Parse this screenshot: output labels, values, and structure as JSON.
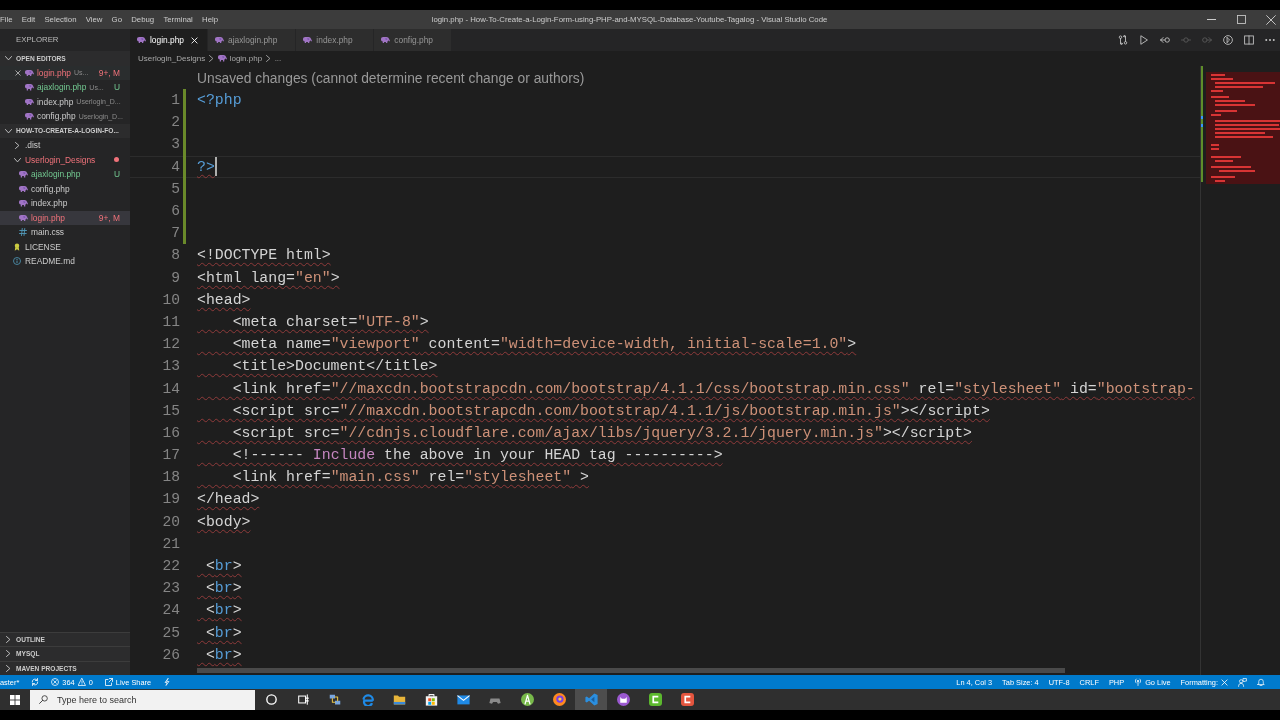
{
  "window": {
    "title": "login.php - How-To-Create-a-Login-Form-using-PHP-and-MYSQL-Database-Youtube-Tagalog - Visual Studio Code"
  },
  "menu": [
    "File",
    "Edit",
    "Selection",
    "View",
    "Go",
    "Debug",
    "Terminal",
    "Help"
  ],
  "sidebar": {
    "title": "EXPLORER",
    "open_editors": {
      "title": "OPEN EDITORS",
      "expanded": true,
      "items": [
        {
          "name": "login.php",
          "description": "Us...",
          "badge": "9+, M",
          "problems": true,
          "untracked": false,
          "kind": "php",
          "selected": true
        },
        {
          "name": "ajaxlogin.php",
          "description": "Us...",
          "badge": "U",
          "problems": false,
          "untracked": true,
          "kind": "php",
          "selected": false
        },
        {
          "name": "index.php",
          "description": "Userlogin_D...",
          "problems": false,
          "untracked": false,
          "kind": "php",
          "selected": false
        },
        {
          "name": "config.php",
          "description": "Userlogin_D...",
          "problems": false,
          "untracked": false,
          "kind": "php",
          "selected": false
        }
      ]
    },
    "workspace": {
      "title": "HOW-TO-CREATE-A-LOGIN-FO...",
      "expanded": true,
      "items": [
        {
          "name": ".dist",
          "kind": "folder",
          "expanded": false,
          "problems": false,
          "untracked": false,
          "selected": false
        },
        {
          "name": "Userlogin_Designs",
          "kind": "folder",
          "expanded": true,
          "problems": true,
          "untracked": false,
          "selected": false,
          "children": [
            {
              "name": "ajaxlogin.php",
              "kind": "php",
              "problems": false,
              "untracked": true,
              "badge": "U",
              "selected": false
            },
            {
              "name": "config.php",
              "kind": "php",
              "problems": false,
              "untracked": false,
              "selected": false
            },
            {
              "name": "index.php",
              "kind": "php",
              "problems": false,
              "untracked": false,
              "selected": false
            },
            {
              "name": "login.php",
              "kind": "php",
              "problems": true,
              "untracked": false,
              "badge": "9+, M",
              "selected": true
            },
            {
              "name": "main.css",
              "kind": "css",
              "problems": false,
              "untracked": false,
              "selected": false
            }
          ]
        },
        {
          "name": "LICENSE",
          "kind": "license",
          "problems": false,
          "untracked": false,
          "selected": false
        },
        {
          "name": "README.md",
          "kind": "info",
          "problems": false,
          "untracked": false,
          "selected": false
        }
      ]
    },
    "panels": [
      {
        "title": "OUTLINE",
        "expanded": false
      },
      {
        "title": "MYSQL",
        "expanded": false
      },
      {
        "title": "MAVEN PROJECTS",
        "expanded": false
      }
    ]
  },
  "tabs": [
    {
      "label": "login.php",
      "selected": true
    },
    {
      "label": "ajaxlogin.php",
      "selected": false
    },
    {
      "label": "index.php",
      "selected": false
    },
    {
      "label": "config.php",
      "selected": false
    }
  ],
  "editor_actions": [
    {
      "kind": "compare",
      "disabled": false
    },
    {
      "kind": "run",
      "disabled": false
    },
    {
      "kind": "previous",
      "disabled": false
    },
    {
      "kind": "commit",
      "disabled": true
    },
    {
      "kind": "next",
      "disabled": true
    },
    {
      "kind": "circle-arrow",
      "disabled": false
    },
    {
      "kind": "split",
      "disabled": false
    },
    {
      "kind": "more",
      "disabled": false
    }
  ],
  "breadcrumbs": [
    {
      "label": "Userlogin_Designs",
      "kind": "folder"
    },
    {
      "label": "login.php",
      "kind": "php"
    },
    {
      "label": "...",
      "kind": "more"
    }
  ],
  "editor": {
    "code_lens": "Unsaved changes (cannot determine recent change or authors)",
    "lines": [
      {
        "number": "1",
        "current": false,
        "changed": true,
        "error": false,
        "tokens": [
          {
            "kind": "php",
            "text": "<?php"
          }
        ]
      },
      {
        "number": "2",
        "current": false,
        "changed": true
      },
      {
        "number": "3",
        "current": false,
        "changed": true
      },
      {
        "number": "4",
        "current": true,
        "changed": true,
        "error": true,
        "tokens": [
          {
            "kind": "php",
            "text": "?>"
          }
        ]
      },
      {
        "number": "5",
        "current": false,
        "changed": true
      },
      {
        "number": "6",
        "current": false,
        "changed": true
      },
      {
        "number": "7",
        "current": false,
        "changed": true
      },
      {
        "number": "8",
        "current": false,
        "changed": false,
        "error": true,
        "tokens": [
          {
            "kind": "plain",
            "text": "<!DOCTYPE html>"
          }
        ]
      },
      {
        "number": "9",
        "current": false,
        "changed": false,
        "error": true,
        "tokens": [
          {
            "kind": "plain",
            "text": "<html lang="
          },
          {
            "kind": "string",
            "text": "\"en\""
          },
          {
            "kind": "plain",
            "text": ">"
          }
        ]
      },
      {
        "number": "10",
        "current": false,
        "changed": false,
        "error": true,
        "tokens": [
          {
            "kind": "plain",
            "text": "<head>"
          }
        ]
      },
      {
        "number": "11",
        "current": false,
        "changed": false,
        "error": true,
        "tokens": [
          {
            "kind": "plain",
            "text": "    <meta charset="
          },
          {
            "kind": "string",
            "text": "\"UTF-8\""
          },
          {
            "kind": "plain",
            "text": ">"
          }
        ]
      },
      {
        "number": "12",
        "current": false,
        "changed": false,
        "error": true,
        "tokens": [
          {
            "kind": "plain",
            "text": "    <meta name="
          },
          {
            "kind": "string",
            "text": "\"viewport\""
          },
          {
            "kind": "plain",
            "text": " content="
          },
          {
            "kind": "string",
            "text": "\"width=device-width, initial-scale=1.0\""
          },
          {
            "kind": "plain",
            "text": ">"
          }
        ]
      },
      {
        "number": "13",
        "current": false,
        "changed": false,
        "error": true,
        "tokens": [
          {
            "kind": "plain",
            "text": "    <title>Document</title>"
          }
        ]
      },
      {
        "number": "14",
        "current": false,
        "changed": false,
        "error": true,
        "tokens": [
          {
            "kind": "plain",
            "text": "    <link href="
          },
          {
            "kind": "string",
            "text": "\"//maxcdn.bootstrapcdn.com/bootstrap/4.1.1/css/bootstrap.min.css\""
          },
          {
            "kind": "plain",
            "text": " rel="
          },
          {
            "kind": "string",
            "text": "\"stylesheet\""
          },
          {
            "kind": "plain",
            "text": " id="
          },
          {
            "kind": "string",
            "text": "\"bootstrap-"
          }
        ]
      },
      {
        "number": "15",
        "current": false,
        "changed": false,
        "error": true,
        "tokens": [
          {
            "kind": "plain",
            "text": "    <script src="
          },
          {
            "kind": "string",
            "text": "\"//maxcdn.bootstrapcdn.com/bootstrap/4.1.1/js/bootstrap.min.js\""
          },
          {
            "kind": "plain",
            "text": "></script>"
          }
        ]
      },
      {
        "number": "16",
        "current": false,
        "changed": false,
        "error": true,
        "tokens": [
          {
            "kind": "plain",
            "text": "    <script src="
          },
          {
            "kind": "string",
            "text": "\"//cdnjs.cloudflare.com/ajax/libs/jquery/3.2.1/jquery.min.js\""
          },
          {
            "kind": "plain",
            "text": "></script>"
          }
        ]
      },
      {
        "number": "17",
        "current": false,
        "changed": false,
        "error": true,
        "tokens": [
          {
            "kind": "plain",
            "text": "    <!------ "
          },
          {
            "kind": "keyword",
            "text": "Include"
          },
          {
            "kind": "plain",
            "text": " the above in your HEAD tag ---------->"
          }
        ]
      },
      {
        "number": "18",
        "current": false,
        "changed": false,
        "error": true,
        "tokens": [
          {
            "kind": "plain",
            "text": "    <link href="
          },
          {
            "kind": "string",
            "text": "\"main.css\""
          },
          {
            "kind": "plain",
            "text": " rel="
          },
          {
            "kind": "string",
            "text": "\"stylesheet\""
          },
          {
            "kind": "plain",
            "text": " >"
          }
        ]
      },
      {
        "number": "19",
        "current": false,
        "changed": false,
        "error": true,
        "tokens": [
          {
            "kind": "plain",
            "text": "</head>"
          }
        ]
      },
      {
        "number": "20",
        "current": false,
        "changed": false,
        "error": true,
        "tokens": [
          {
            "kind": "plain",
            "text": "<body>"
          }
        ]
      },
      {
        "number": "21",
        "current": false,
        "changed": false
      },
      {
        "number": "22",
        "current": false,
        "changed": false,
        "error": true,
        "tokens": [
          {
            "kind": "plain",
            "text": " <"
          },
          {
            "kind": "tag",
            "text": "br"
          },
          {
            "kind": "plain",
            "text": ">"
          }
        ]
      },
      {
        "number": "23",
        "current": false,
        "changed": false,
        "error": true,
        "tokens": [
          {
            "kind": "plain",
            "text": " <"
          },
          {
            "kind": "tag",
            "text": "br"
          },
          {
            "kind": "plain",
            "text": ">"
          }
        ]
      },
      {
        "number": "24",
        "current": false,
        "changed": false,
        "error": true,
        "tokens": [
          {
            "kind": "plain",
            "text": " <"
          },
          {
            "kind": "tag",
            "text": "br"
          },
          {
            "kind": "plain",
            "text": ">"
          }
        ]
      },
      {
        "number": "25",
        "current": false,
        "changed": false,
        "error": true,
        "tokens": [
          {
            "kind": "plain",
            "text": " <"
          },
          {
            "kind": "tag",
            "text": "br"
          },
          {
            "kind": "plain",
            "text": ">"
          }
        ]
      },
      {
        "number": "26",
        "current": false,
        "changed": false,
        "error": true,
        "tokens": [
          {
            "kind": "plain",
            "text": " <"
          },
          {
            "kind": "tag",
            "text": "br"
          },
          {
            "kind": "plain",
            "text": ">"
          }
        ]
      }
    ]
  },
  "status_bar": {
    "left": [
      {
        "kind": "branch",
        "text": "aster*"
      },
      {
        "kind": "sync"
      },
      {
        "kind": "problems",
        "errors": "364",
        "warnings": "0"
      },
      {
        "kind": "live-share",
        "text": "Live Share"
      },
      {
        "kind": "lightning"
      }
    ],
    "right": [
      {
        "kind": "text",
        "text": "Ln 4, Col 3"
      },
      {
        "kind": "text",
        "text": "Tab Size: 4"
      },
      {
        "kind": "text",
        "text": "UTF-8"
      },
      {
        "kind": "text",
        "text": "CRLF"
      },
      {
        "kind": "text",
        "text": "PHP"
      },
      {
        "kind": "go-live",
        "text": "Go Live"
      },
      {
        "kind": "formatting",
        "text": "Formatting:"
      },
      {
        "kind": "feedback"
      },
      {
        "kind": "bell"
      }
    ]
  },
  "taskbar": {
    "search": {
      "placeholder": "Type here to search"
    },
    "apps": [
      {
        "kind": "ring",
        "selected": false
      },
      {
        "kind": "task-view",
        "selected": false
      },
      {
        "kind": "computers",
        "selected": false
      },
      {
        "kind": "swirl",
        "selected": false
      },
      {
        "kind": "folder",
        "selected": false
      },
      {
        "kind": "bag",
        "selected": false
      },
      {
        "kind": "envelope",
        "selected": false
      },
      {
        "kind": "gamepad",
        "selected": false
      },
      {
        "kind": "compass",
        "selected": false
      },
      {
        "kind": "orb",
        "selected": false
      },
      {
        "kind": "ribbon",
        "selected": true
      },
      {
        "kind": "cat",
        "selected": false
      },
      {
        "kind": "bracket-tile",
        "color": "#5cb82e",
        "selected": false
      },
      {
        "kind": "bracket-tile",
        "color": "#e4553e",
        "selected": false
      }
    ]
  }
}
